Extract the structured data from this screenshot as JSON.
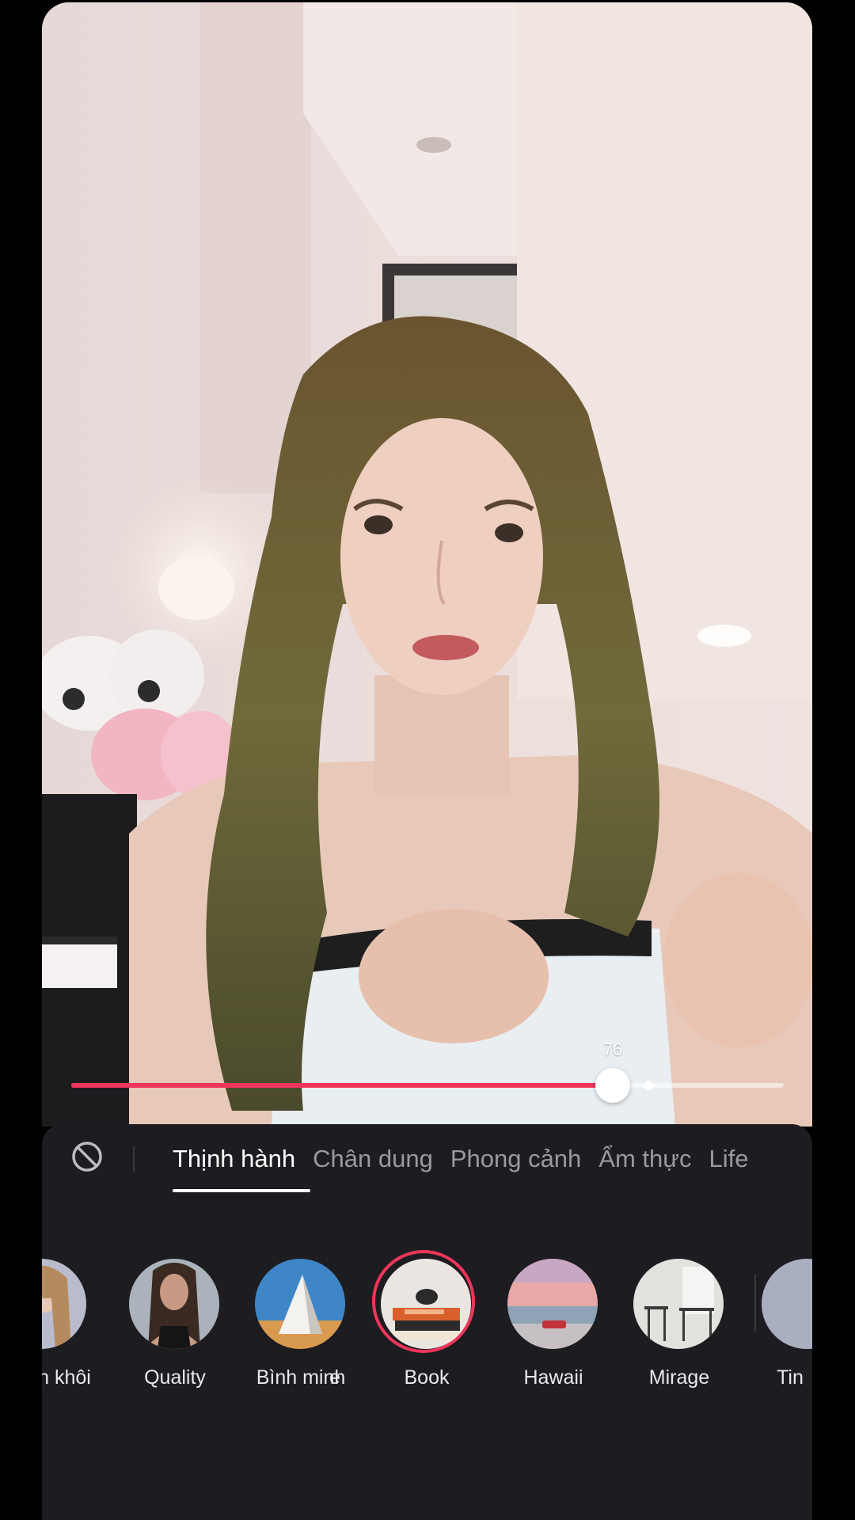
{
  "beauty_slider": {
    "value_label": "76",
    "value": 0.76,
    "default_marker": 0.81,
    "accent_color": "#f0355a"
  },
  "filter_panel": {
    "none_icon": "prohibited-icon",
    "tabs": [
      {
        "label": "Thịnh hành",
        "active": true
      },
      {
        "label": "Chân dung",
        "active": false
      },
      {
        "label": "Phong cảnh",
        "active": false
      },
      {
        "label": "Ẩm thực",
        "active": false
      },
      {
        "label": "Life",
        "active": false
      }
    ],
    "filters": [
      {
        "label": "Thanh khôi",
        "selected": false
      },
      {
        "label": "Quality",
        "selected": false
      },
      {
        "label": "Bình minh",
        "selected": false
      },
      {
        "label": "e",
        "selected": false
      },
      {
        "label": "Book",
        "selected": true
      },
      {
        "label": "Hawaii",
        "selected": false
      },
      {
        "label": "Mirage",
        "selected": false
      },
      {
        "label": "Tin",
        "selected": false
      }
    ]
  }
}
